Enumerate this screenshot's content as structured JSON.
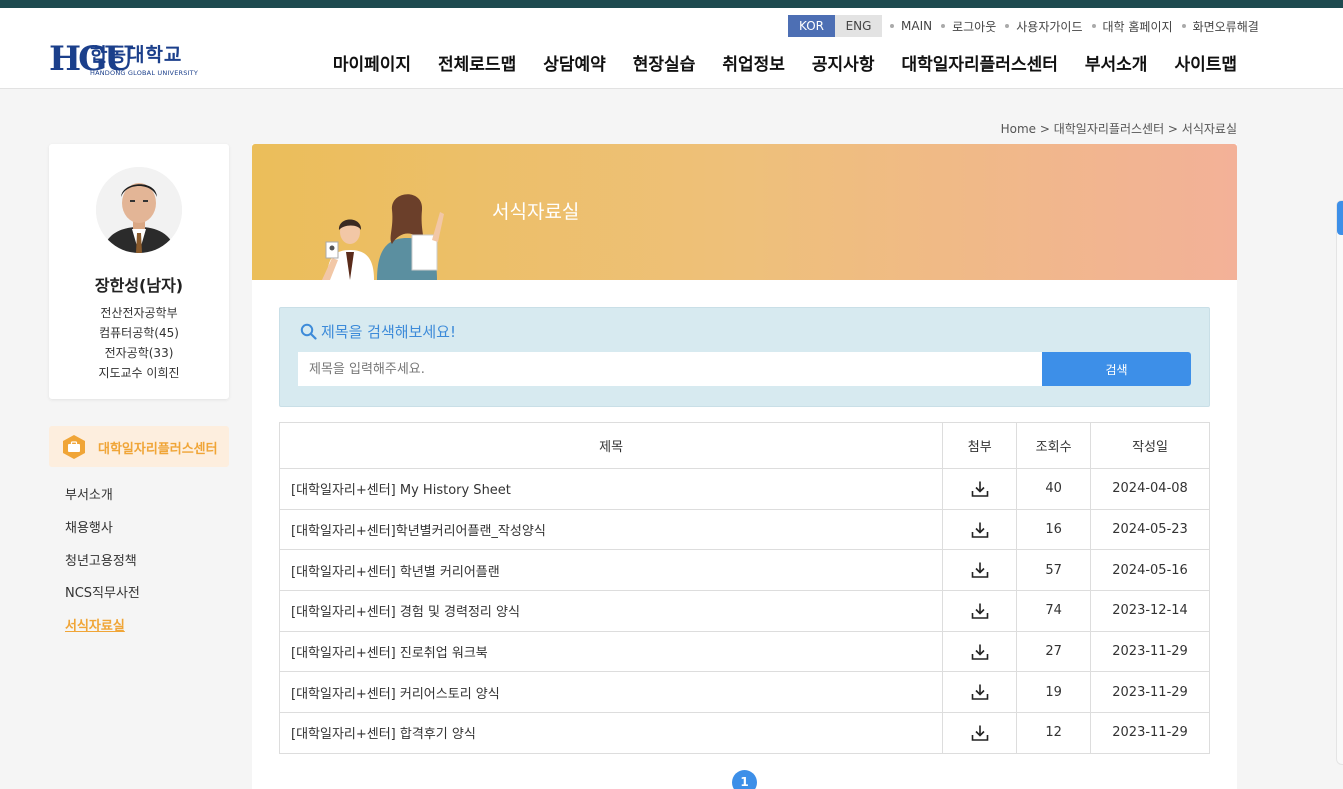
{
  "header": {
    "logo": {
      "kor": "한동대학교",
      "eng": "HANDONG GLOBAL UNIVERSITY",
      "mark": "HGU"
    },
    "lang": {
      "kor": "KOR",
      "eng": "ENG"
    },
    "util": [
      "MAIN",
      "로그아웃",
      "사용자가이드",
      "대학 홈페이지",
      "화면오류해결"
    ],
    "nav": [
      "마이페이지",
      "전체로드맵",
      "상담예약",
      "현장실습",
      "취업정보",
      "공지사항",
      "대학일자리플러스센터",
      "부서소개",
      "사이트맵"
    ]
  },
  "breadcrumb": "Home > 대학일자리플러스센터 > 서식자료실",
  "profile": {
    "name": "장한성(남자)",
    "lines": [
      "전산전자공학부",
      "컴퓨터공학(45)",
      "전자공학(33)",
      "지도교수 이희진"
    ]
  },
  "side_nav": {
    "title": "대학일자리플러스센터",
    "items": [
      "부서소개",
      "채용행사",
      "청년고용정책",
      "NCS직무사전",
      "서식자료실"
    ],
    "active": "서식자료실"
  },
  "banner": {
    "title": "서식자료실"
  },
  "search": {
    "title": "제목을 검색해보세요!",
    "placeholder": "제목을 입력해주세요.",
    "value": "",
    "button": "검색"
  },
  "table": {
    "headers": [
      "제목",
      "첨부",
      "조회수",
      "작성일"
    ],
    "rows": [
      {
        "title": "[대학일자리+센터] My History Sheet",
        "views": "40",
        "date": "2024-04-08"
      },
      {
        "title": "[대학일자리+센터]학년별커리어플랜_작성양식",
        "views": "16",
        "date": "2024-05-23"
      },
      {
        "title": "[대학일자리+센터] 학년별 커리어플랜",
        "views": "57",
        "date": "2024-05-16"
      },
      {
        "title": "[대학일자리+센터] 경험 및 경력정리 양식",
        "views": "74",
        "date": "2023-12-14"
      },
      {
        "title": "[대학일자리+센터] 진로취업 워크북",
        "views": "27",
        "date": "2023-11-29"
      },
      {
        "title": "[대학일자리+센터] 커리어스토리 양식",
        "views": "19",
        "date": "2023-11-29"
      },
      {
        "title": "[대학일자리+센터] 합격후기 양식",
        "views": "12",
        "date": "2023-11-29"
      }
    ]
  },
  "pagination": {
    "current": "1"
  },
  "colors": {
    "accent": "#3d8fe8",
    "side_accent": "#f0a537",
    "banner_from": "#ebbe5a",
    "banner_to": "#f3b198"
  }
}
